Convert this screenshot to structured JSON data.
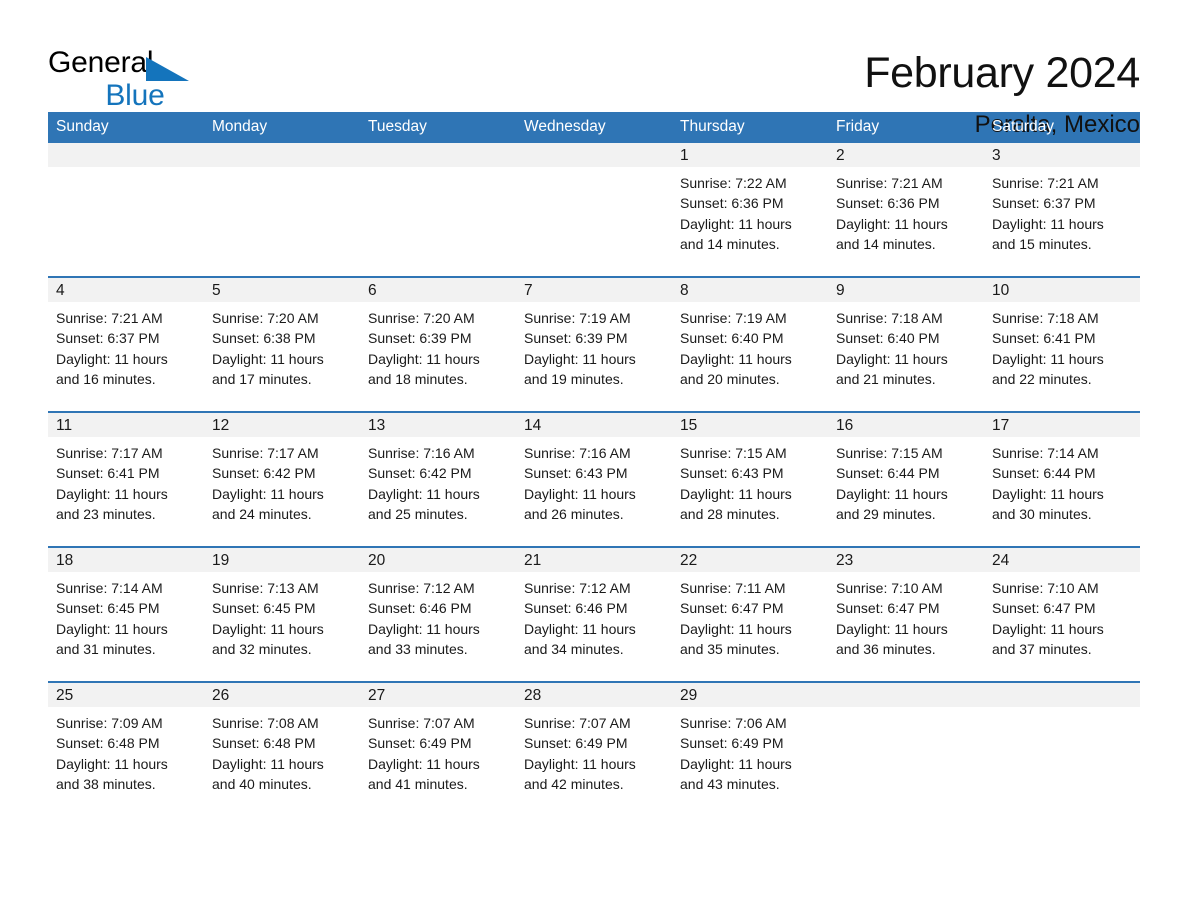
{
  "brand": {
    "name_top": "General",
    "name_bottom": "Blue",
    "triangle_color": "#1474bc"
  },
  "header": {
    "title": "February 2024",
    "subtitle": "Peralta, Mexico"
  },
  "colors": {
    "header_blue": "#2f75b5",
    "daynum_band": "#f2f2f2",
    "text": "#1a1a1a"
  },
  "weekdays": [
    "Sunday",
    "Monday",
    "Tuesday",
    "Wednesday",
    "Thursday",
    "Friday",
    "Saturday"
  ],
  "weeks": [
    [
      {
        "day": "",
        "lines": []
      },
      {
        "day": "",
        "lines": []
      },
      {
        "day": "",
        "lines": []
      },
      {
        "day": "",
        "lines": []
      },
      {
        "day": "1",
        "lines": [
          "Sunrise: 7:22 AM",
          "Sunset: 6:36 PM",
          "Daylight: 11 hours",
          "and 14 minutes."
        ]
      },
      {
        "day": "2",
        "lines": [
          "Sunrise: 7:21 AM",
          "Sunset: 6:36 PM",
          "Daylight: 11 hours",
          "and 14 minutes."
        ]
      },
      {
        "day": "3",
        "lines": [
          "Sunrise: 7:21 AM",
          "Sunset: 6:37 PM",
          "Daylight: 11 hours",
          "and 15 minutes."
        ]
      }
    ],
    [
      {
        "day": "4",
        "lines": [
          "Sunrise: 7:21 AM",
          "Sunset: 6:37 PM",
          "Daylight: 11 hours",
          "and 16 minutes."
        ]
      },
      {
        "day": "5",
        "lines": [
          "Sunrise: 7:20 AM",
          "Sunset: 6:38 PM",
          "Daylight: 11 hours",
          "and 17 minutes."
        ]
      },
      {
        "day": "6",
        "lines": [
          "Sunrise: 7:20 AM",
          "Sunset: 6:39 PM",
          "Daylight: 11 hours",
          "and 18 minutes."
        ]
      },
      {
        "day": "7",
        "lines": [
          "Sunrise: 7:19 AM",
          "Sunset: 6:39 PM",
          "Daylight: 11 hours",
          "and 19 minutes."
        ]
      },
      {
        "day": "8",
        "lines": [
          "Sunrise: 7:19 AM",
          "Sunset: 6:40 PM",
          "Daylight: 11 hours",
          "and 20 minutes."
        ]
      },
      {
        "day": "9",
        "lines": [
          "Sunrise: 7:18 AM",
          "Sunset: 6:40 PM",
          "Daylight: 11 hours",
          "and 21 minutes."
        ]
      },
      {
        "day": "10",
        "lines": [
          "Sunrise: 7:18 AM",
          "Sunset: 6:41 PM",
          "Daylight: 11 hours",
          "and 22 minutes."
        ]
      }
    ],
    [
      {
        "day": "11",
        "lines": [
          "Sunrise: 7:17 AM",
          "Sunset: 6:41 PM",
          "Daylight: 11 hours",
          "and 23 minutes."
        ]
      },
      {
        "day": "12",
        "lines": [
          "Sunrise: 7:17 AM",
          "Sunset: 6:42 PM",
          "Daylight: 11 hours",
          "and 24 minutes."
        ]
      },
      {
        "day": "13",
        "lines": [
          "Sunrise: 7:16 AM",
          "Sunset: 6:42 PM",
          "Daylight: 11 hours",
          "and 25 minutes."
        ]
      },
      {
        "day": "14",
        "lines": [
          "Sunrise: 7:16 AM",
          "Sunset: 6:43 PM",
          "Daylight: 11 hours",
          "and 26 minutes."
        ]
      },
      {
        "day": "15",
        "lines": [
          "Sunrise: 7:15 AM",
          "Sunset: 6:43 PM",
          "Daylight: 11 hours",
          "and 28 minutes."
        ]
      },
      {
        "day": "16",
        "lines": [
          "Sunrise: 7:15 AM",
          "Sunset: 6:44 PM",
          "Daylight: 11 hours",
          "and 29 minutes."
        ]
      },
      {
        "day": "17",
        "lines": [
          "Sunrise: 7:14 AM",
          "Sunset: 6:44 PM",
          "Daylight: 11 hours",
          "and 30 minutes."
        ]
      }
    ],
    [
      {
        "day": "18",
        "lines": [
          "Sunrise: 7:14 AM",
          "Sunset: 6:45 PM",
          "Daylight: 11 hours",
          "and 31 minutes."
        ]
      },
      {
        "day": "19",
        "lines": [
          "Sunrise: 7:13 AM",
          "Sunset: 6:45 PM",
          "Daylight: 11 hours",
          "and 32 minutes."
        ]
      },
      {
        "day": "20",
        "lines": [
          "Sunrise: 7:12 AM",
          "Sunset: 6:46 PM",
          "Daylight: 11 hours",
          "and 33 minutes."
        ]
      },
      {
        "day": "21",
        "lines": [
          "Sunrise: 7:12 AM",
          "Sunset: 6:46 PM",
          "Daylight: 11 hours",
          "and 34 minutes."
        ]
      },
      {
        "day": "22",
        "lines": [
          "Sunrise: 7:11 AM",
          "Sunset: 6:47 PM",
          "Daylight: 11 hours",
          "and 35 minutes."
        ]
      },
      {
        "day": "23",
        "lines": [
          "Sunrise: 7:10 AM",
          "Sunset: 6:47 PM",
          "Daylight: 11 hours",
          "and 36 minutes."
        ]
      },
      {
        "day": "24",
        "lines": [
          "Sunrise: 7:10 AM",
          "Sunset: 6:47 PM",
          "Daylight: 11 hours",
          "and 37 minutes."
        ]
      }
    ],
    [
      {
        "day": "25",
        "lines": [
          "Sunrise: 7:09 AM",
          "Sunset: 6:48 PM",
          "Daylight: 11 hours",
          "and 38 minutes."
        ]
      },
      {
        "day": "26",
        "lines": [
          "Sunrise: 7:08 AM",
          "Sunset: 6:48 PM",
          "Daylight: 11 hours",
          "and 40 minutes."
        ]
      },
      {
        "day": "27",
        "lines": [
          "Sunrise: 7:07 AM",
          "Sunset: 6:49 PM",
          "Daylight: 11 hours",
          "and 41 minutes."
        ]
      },
      {
        "day": "28",
        "lines": [
          "Sunrise: 7:07 AM",
          "Sunset: 6:49 PM",
          "Daylight: 11 hours",
          "and 42 minutes."
        ]
      },
      {
        "day": "29",
        "lines": [
          "Sunrise: 7:06 AM",
          "Sunset: 6:49 PM",
          "Daylight: 11 hours",
          "and 43 minutes."
        ]
      },
      {
        "day": "",
        "lines": []
      },
      {
        "day": "",
        "lines": []
      }
    ]
  ]
}
